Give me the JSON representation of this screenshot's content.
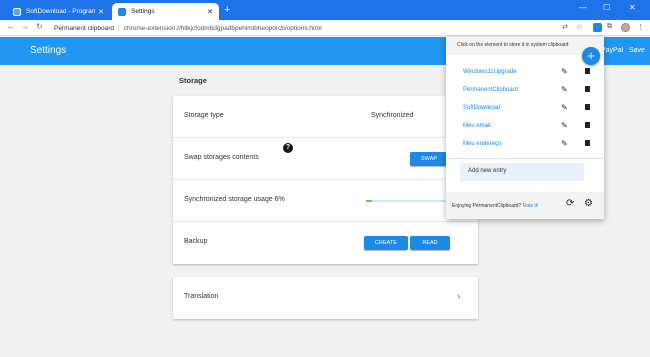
{
  "browser": {
    "tabs": [
      {
        "title": "SoftDownload - Programas e jogos",
        "active": false
      },
      {
        "title": "Settings",
        "active": true
      }
    ],
    "new_tab": "+",
    "address": {
      "site": "Permanent clipboard",
      "url": "chrome-extension://hllkjcfodmbdgpadbpehimibheoporcb/options.html"
    },
    "window_controls": {
      "minimize": "—",
      "maximize": "☐",
      "close": "✕"
    }
  },
  "header": {
    "title": "Settings",
    "paypal": "PayPal",
    "save": "Save"
  },
  "storage": {
    "section_title": "Storage",
    "type_label": "Storage type",
    "type_value": "Synchronized",
    "swap_label": "Swap storages contents",
    "swap_button": "SWAP",
    "usage_label": "Synchronized storage usage 6%",
    "usage_percent": 6,
    "backup_label": "Backup",
    "create_button": "CREATE",
    "read_button": "READ",
    "help": "?"
  },
  "translation": {
    "label": "Translation"
  },
  "popup": {
    "hint": "Click on the element to store it in system clipboard",
    "add": "+",
    "entries": [
      {
        "name": "Windows11Upgrade"
      },
      {
        "name": "PermanentClipboard"
      },
      {
        "name": "SoftDownload"
      },
      {
        "name": "Meu email"
      },
      {
        "name": "Meu endereço"
      }
    ],
    "add_entry": "Add new entry",
    "footer_text": "Enjoying PermanentClipboard?",
    "rate": "Rate it!"
  },
  "colors": {
    "accent": "#1e88e5",
    "header": "#2196f3",
    "tabstrip": "#1e73e8",
    "progress": "#7cc242"
  },
  "icons": [
    "back-arrow-icon",
    "forward-arrow-icon",
    "reload-icon",
    "translate-icon",
    "star-icon",
    "extension-icon",
    "menu-dots-icon",
    "pencil-icon",
    "trash-icon",
    "sync-icon",
    "gear-icon",
    "chevron-right-icon"
  ]
}
